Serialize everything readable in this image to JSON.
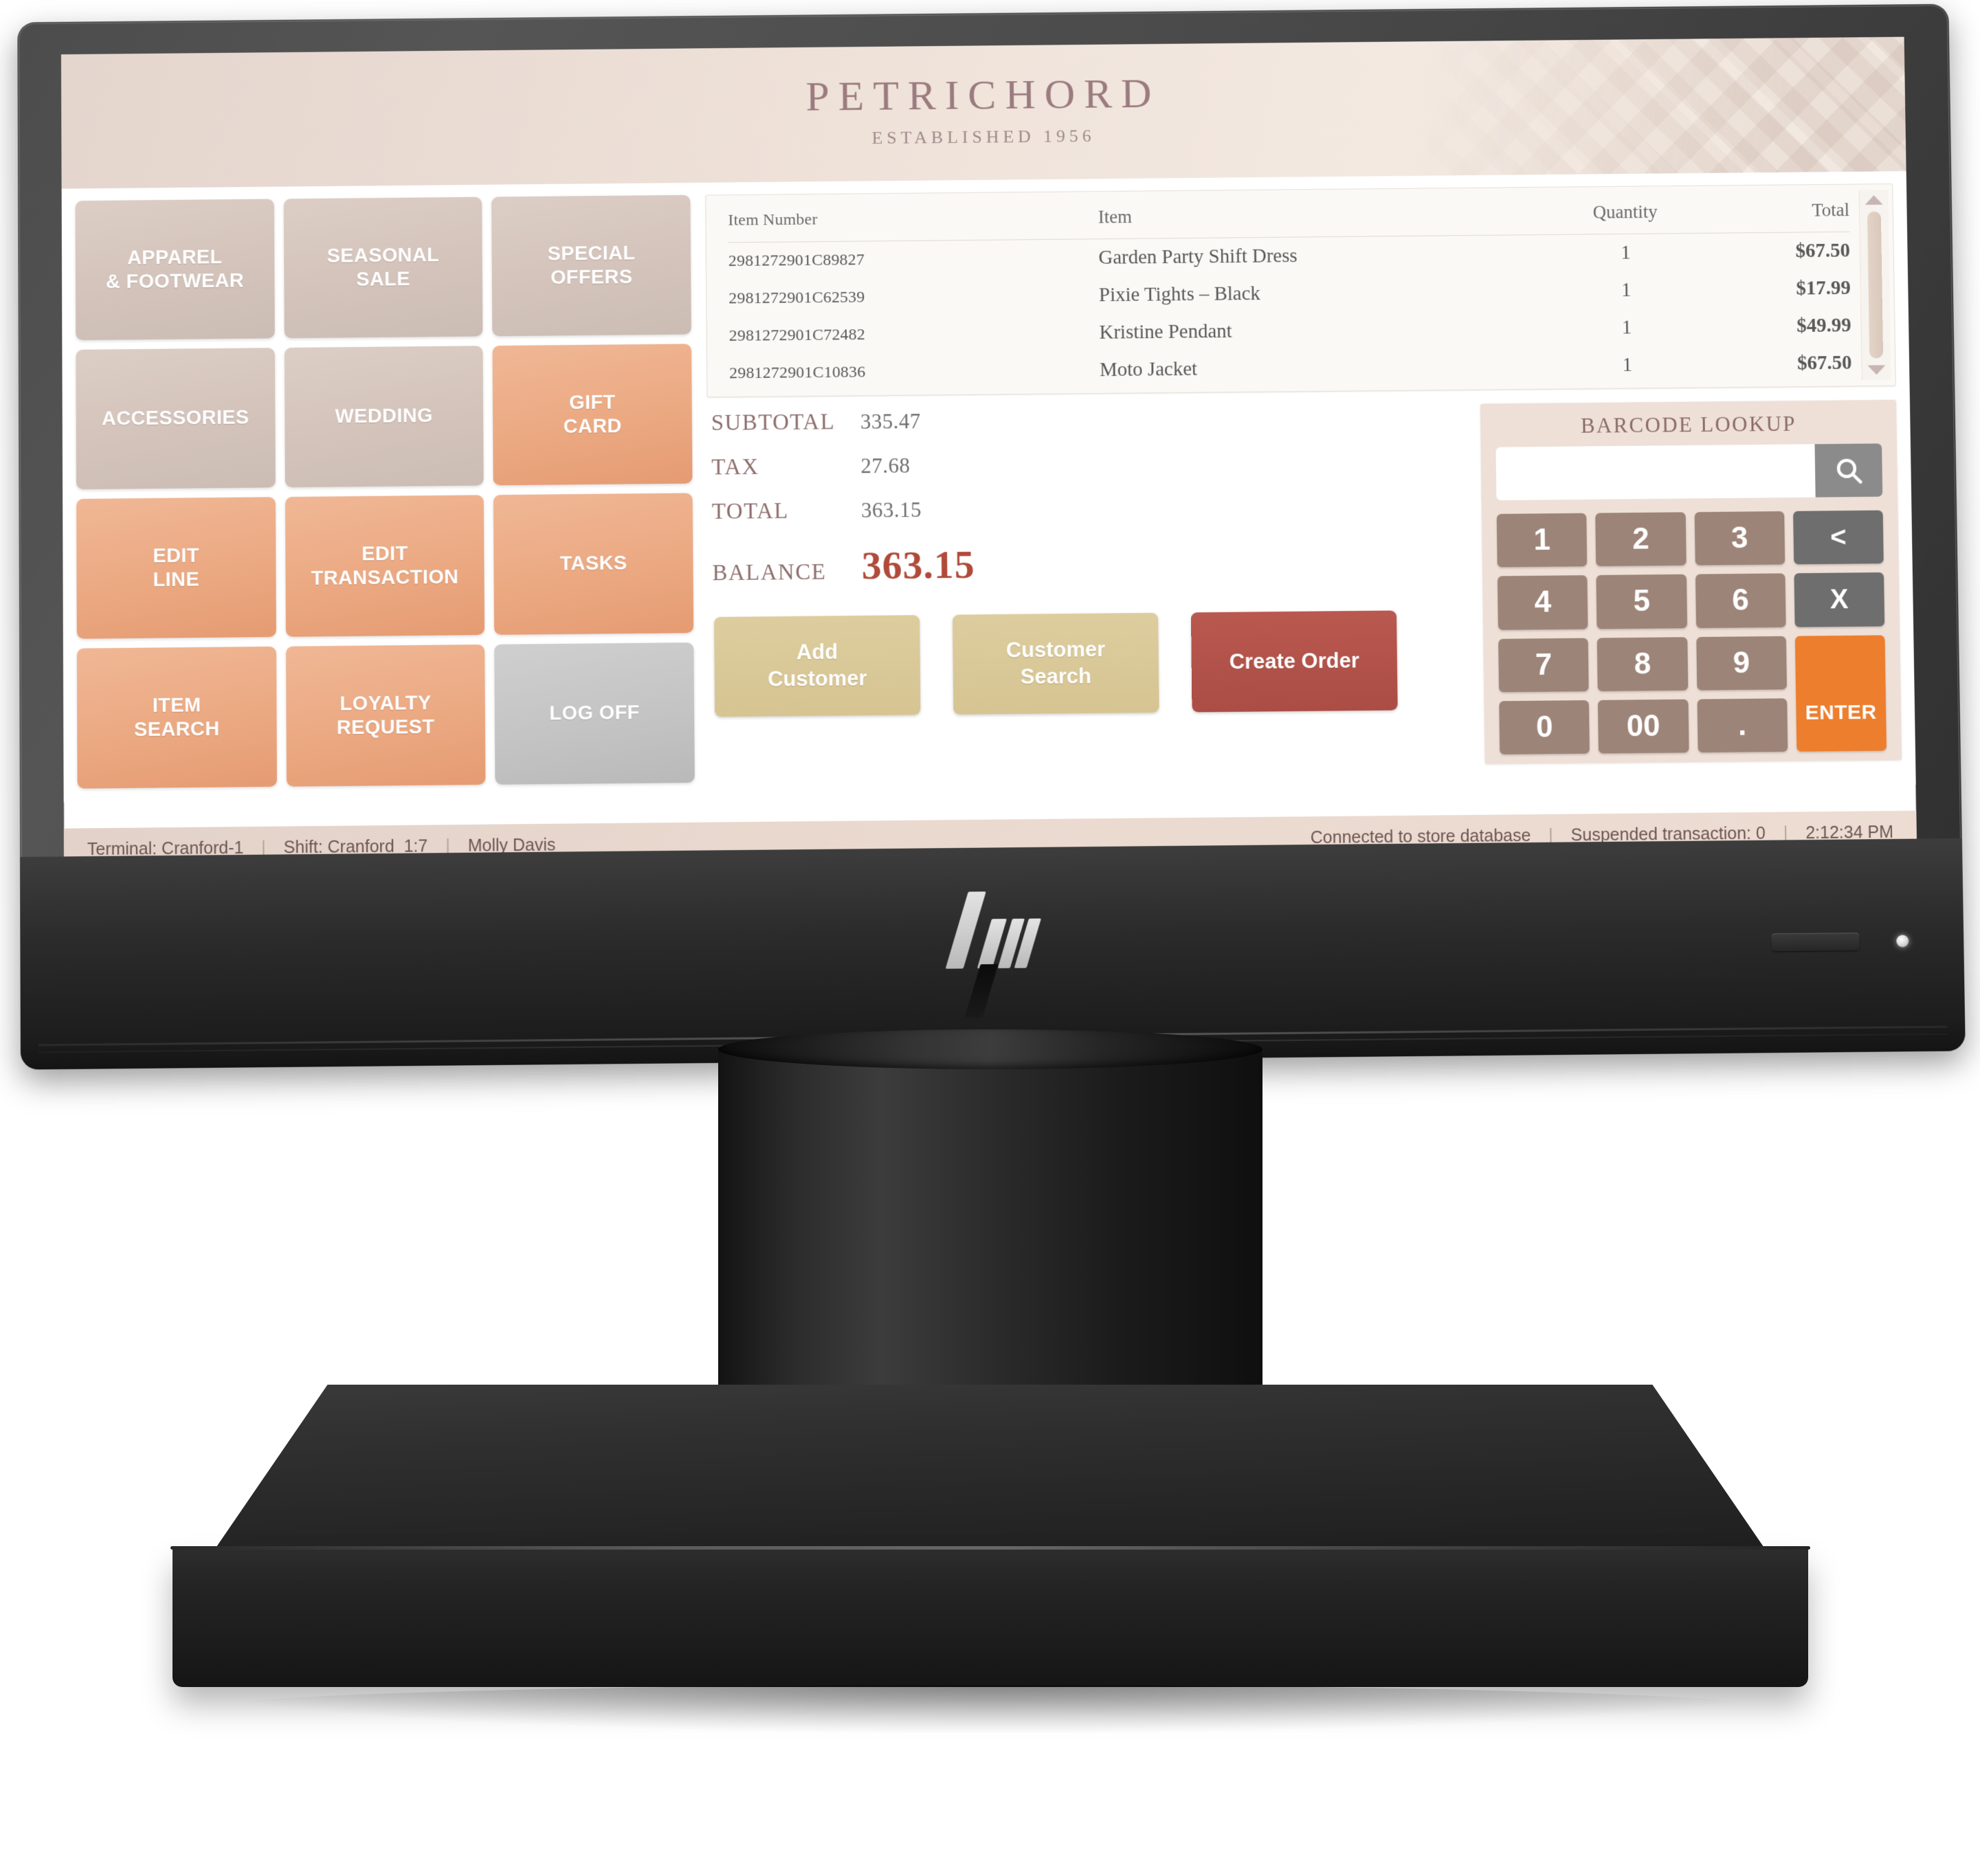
{
  "device": {
    "brand_logo": "hp-logo",
    "power_button": "power-button",
    "power_led": "power-led"
  },
  "header": {
    "brand_name": "PETRICHORD",
    "brand_tagline": "ESTABLISHED 1956"
  },
  "tiles": [
    {
      "label_line1": "APPAREL",
      "label_line2": "& FOOTWEAR",
      "style": "neutral",
      "name": "tile-apparel-footwear"
    },
    {
      "label_line1": "SEASONAL",
      "label_line2": "SALE",
      "style": "neutral",
      "name": "tile-seasonal-sale"
    },
    {
      "label_line1": "SPECIAL",
      "label_line2": "OFFERS",
      "style": "neutral",
      "name": "tile-special-offers"
    },
    {
      "label_line1": "ACCESSORIES",
      "label_line2": "",
      "style": "neutral",
      "name": "tile-accessories"
    },
    {
      "label_line1": "WEDDING",
      "label_line2": "",
      "style": "neutral",
      "name": "tile-wedding"
    },
    {
      "label_line1": "GIFT",
      "label_line2": "CARD",
      "style": "accent",
      "name": "tile-gift-card"
    },
    {
      "label_line1": "EDIT",
      "label_line2": "LINE",
      "style": "accent",
      "name": "tile-edit-line"
    },
    {
      "label_line1": "EDIT",
      "label_line2": "TRANSACTION",
      "style": "accent",
      "name": "tile-edit-transaction"
    },
    {
      "label_line1": "TASKS",
      "label_line2": "",
      "style": "accent",
      "name": "tile-tasks"
    },
    {
      "label_line1": "ITEM",
      "label_line2": "SEARCH",
      "style": "accent",
      "name": "tile-item-search"
    },
    {
      "label_line1": "LOYALTY",
      "label_line2": "REQUEST",
      "style": "accent",
      "name": "tile-loyalty-request"
    },
    {
      "label_line1": "LOG OFF",
      "label_line2": "",
      "style": "grey",
      "name": "tile-log-off"
    }
  ],
  "transaction": {
    "columns": {
      "item_number": "Item Number",
      "item": "Item",
      "quantity": "Quantity",
      "total": "Total"
    },
    "rows": [
      {
        "item_number": "2981272901C89827",
        "item": "Garden Party Shift Dress",
        "quantity": "1",
        "total": "$67.50"
      },
      {
        "item_number": "2981272901C62539",
        "item": "Pixie Tights – Black",
        "quantity": "1",
        "total": "$17.99"
      },
      {
        "item_number": "2981272901C72482",
        "item": "Kristine Pendant",
        "quantity": "1",
        "total": "$49.99"
      },
      {
        "item_number": "2981272901C10836",
        "item": "Moto Jacket",
        "quantity": "1",
        "total": "$67.50"
      }
    ],
    "scroll_up": "scroll-up-arrow",
    "scroll_down": "scroll-down-arrow"
  },
  "totals": {
    "subtotal_label": "SUBTOTAL",
    "subtotal_value": "335.47",
    "tax_label": "TAX",
    "tax_value": "27.68",
    "total_label": "TOTAL",
    "total_value": "363.15",
    "balance_label": "BALANCE",
    "balance_value": "363.15",
    "balance_color": "#b04a39"
  },
  "actions": [
    {
      "line1": "Add",
      "line2": "Customer",
      "style": "act-tan",
      "name": "add-customer-button"
    },
    {
      "line1": "Customer",
      "line2": "Search",
      "style": "act-tan",
      "name": "customer-search-button"
    },
    {
      "line1": "Create Order",
      "line2": "",
      "style": "act-red",
      "name": "create-order-button"
    }
  ],
  "barcode": {
    "title": "BARCODE LOOKUP",
    "input_value": "",
    "input_placeholder": "",
    "search_icon": "search-icon",
    "keys": [
      {
        "label": "1",
        "style": "num",
        "name": "keypad-1"
      },
      {
        "label": "2",
        "style": "num",
        "name": "keypad-2"
      },
      {
        "label": "3",
        "style": "num",
        "name": "keypad-3"
      },
      {
        "label": "<",
        "style": "dark",
        "name": "keypad-backspace"
      },
      {
        "label": "4",
        "style": "num",
        "name": "keypad-4"
      },
      {
        "label": "5",
        "style": "num",
        "name": "keypad-5"
      },
      {
        "label": "6",
        "style": "num",
        "name": "keypad-6"
      },
      {
        "label": "X",
        "style": "dark",
        "name": "keypad-clear"
      },
      {
        "label": "7",
        "style": "num",
        "name": "keypad-7"
      },
      {
        "label": "8",
        "style": "num",
        "name": "keypad-8"
      },
      {
        "label": "9",
        "style": "num",
        "name": "keypad-9"
      },
      {
        "label": "ENTER",
        "style": "enter",
        "name": "keypad-enter"
      },
      {
        "label": "0",
        "style": "num",
        "name": "keypad-0"
      },
      {
        "label": "00",
        "style": "num",
        "name": "keypad-00"
      },
      {
        "label": ".",
        "style": "num dot",
        "name": "keypad-decimal"
      }
    ]
  },
  "status_bar": {
    "terminal": "Terminal: Cranford-1",
    "shift": "Shift: Cranford_1:7",
    "user": "Molly Davis",
    "connection": "Connected to store database",
    "suspended": "Suspended transaction: 0",
    "time": "2:12:34 PM",
    "separator": "|"
  },
  "colors": {
    "accent_orange": "#eba982",
    "enter_orange": "#ec7e2e",
    "brand_mauve": "#9b7b7f",
    "balance_red": "#b04a39",
    "tan_button": "#d6c492",
    "red_button": "#b9584f"
  }
}
